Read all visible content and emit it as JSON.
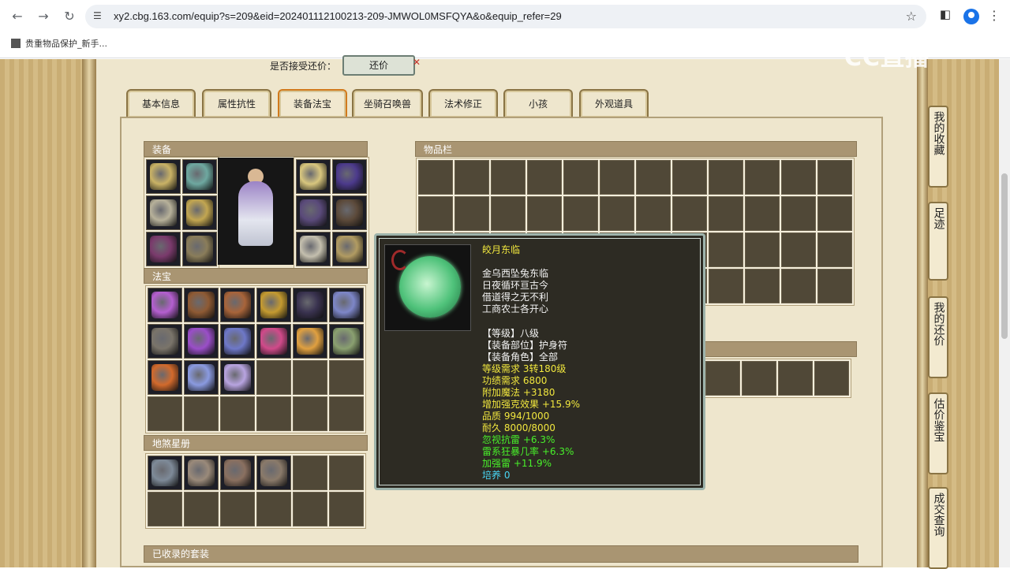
{
  "browser": {
    "url": "xy2.cbg.163.com/equip?s=209&eid=202401112100213-209-JMWOL0MSFQYA&o&equip_refer=29",
    "bookmark": "贵重物品保护_新手..."
  },
  "watermark": "CC直播",
  "offer": {
    "label": "是否接受还价：",
    "button": "还价",
    "close": "✕"
  },
  "tabs": [
    {
      "label": "基本信息"
    },
    {
      "label": "属性抗性"
    },
    {
      "label": "装备法宝"
    },
    {
      "label": "坐骑召唤兽"
    },
    {
      "label": "法术修正"
    },
    {
      "label": "小孩"
    },
    {
      "label": "外观道具"
    }
  ],
  "sections": {
    "equipment": "装备",
    "treasure": "法宝",
    "stars": "地煞星册",
    "inventory": "物品栏",
    "suits": "已收录的套装"
  },
  "sidenav": [
    {
      "label": "我的收藏"
    },
    {
      "label": "足迹"
    },
    {
      "label": "我的还价"
    },
    {
      "label": "估价鉴宝"
    },
    {
      "label": "成交查询"
    }
  ],
  "icon_colors": {
    "equipment": [
      "#c9b265",
      "#6ea8a0",
      "#b7b19a",
      "#c2a651",
      "#7a3a6c",
      "#8a7d5a",
      "#d8c67e",
      "#4c3a8c",
      "#5a4a7a",
      "#5c4a3a",
      "#c4bfae",
      "#b19b62",
      "#57c47a"
    ],
    "treasure": [
      "#b45fd0",
      "#8e5a34",
      "#a8643a",
      "#c49a30",
      "#3a3350",
      "#7d86c8",
      "#7a746a",
      "#9a4ec8",
      "#6e78c8",
      "#d04a8a",
      "#e0a040",
      "#8aa070",
      "#d26a2c",
      "#8a9ae0",
      "#b8a4e0"
    ],
    "stars": [
      "#7e8a98",
      "#9a8a7a",
      "#8a7060",
      "#8a7a6a"
    ]
  },
  "tooltip": {
    "name": "皎月东临",
    "poem": [
      "金乌西坠兔东临",
      "日夜循环亘古今",
      "借道得之无不利",
      "工商农士各开心"
    ],
    "attrs": [
      "【等级】八级",
      "【装备部位】护身符",
      "【装备角色】全部"
    ],
    "stats": [
      "等级需求 3转180级",
      "功绩需求 6800",
      "附加魔法 +3180",
      "增加强克效果 +15.9%",
      "品质 994/1000",
      "耐久 8000/8000"
    ],
    "bonus": [
      "忽视抗雷 +6.3%",
      "雷系狂暴几率 +6.3%",
      "加强雷 +11.9%"
    ],
    "culture": "培养 0"
  }
}
